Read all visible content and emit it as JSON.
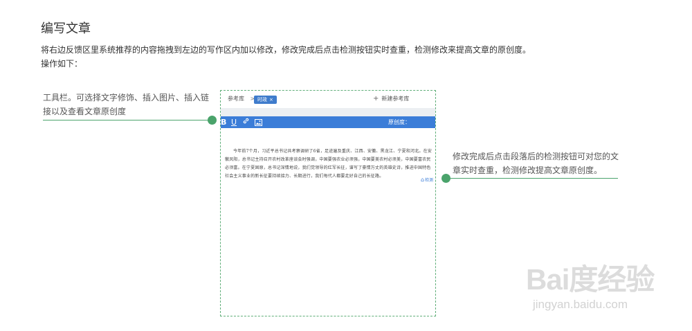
{
  "header": {
    "title": "编写文章",
    "description": "将右边反馈区里系统推荐的内容拖拽到左边的写作区内加以修改，修改完成后点击检测按钮实时查重，检测修改来提高文章的原创度。",
    "steps_label": "操作如下："
  },
  "annotations": {
    "left": "工具栏。可选择文字修饰、插入图片、插入链接以及查看文章原创度",
    "right": "修改完成后点击段落后的检测按钮可对您的文章实时查重，检测修改提高文章原创度。"
  },
  "editor": {
    "ref_library_label": "参考库",
    "ref_chevron": ">",
    "active_tag": "时政",
    "tag_close": "×",
    "new_ref_label": "新建参考库",
    "new_ref_plus": "+",
    "toolbar": {
      "bold": "B",
      "underline": "U",
      "link": "🔗",
      "image": "🖼",
      "originality_label": "原创度："
    },
    "body_text": "今年前7个月，习近平总书记共考察调研了6省，足迹遍及重庆、江西、安徽、黑龙江、宁夏和河北。在安徽凤阳，总书记主持召开农村改革座谈会时强调，中国要强农业必须强，中国要美农村必须美，中国要富农民必须富。在宁夏固原，总书记深情地说，我们党领导的红军长征，谱写了豪情万丈的英雄史诗，推进中国特色社会主义事业的新长征要持续接力、长期进行，我们每代人都要走好自己的长征路。",
    "check_button": "检测"
  },
  "watermark": {
    "main": "Bai度经验",
    "sub": "jingyan.baidu.com"
  },
  "colors": {
    "accent_green": "#4aa36b",
    "toolbar_blue": "#3b7dd8",
    "tag_blue": "#3f7ccc"
  }
}
